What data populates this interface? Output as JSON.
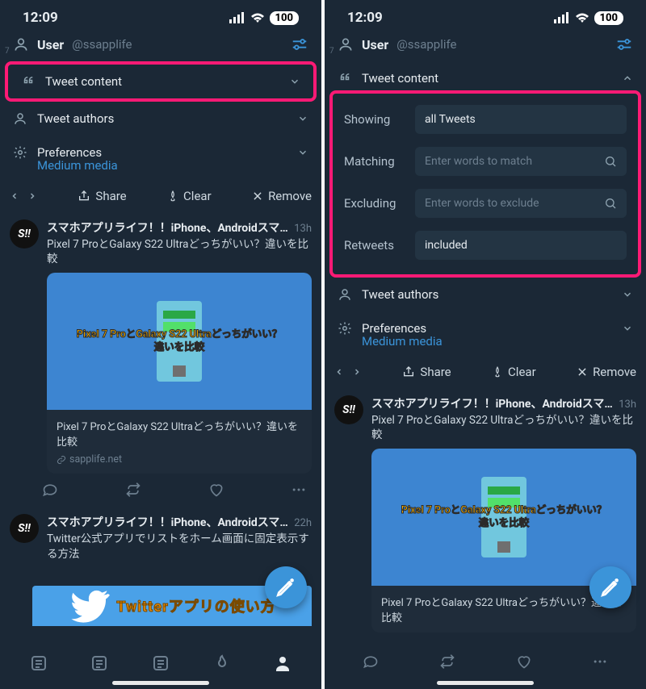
{
  "status": {
    "time": "12:09",
    "battery": "100"
  },
  "col_index_left": "7",
  "col_index_right": "7",
  "header": {
    "name": "User",
    "handle": "@ssapplife"
  },
  "sections": {
    "tweet_content": "Tweet content",
    "tweet_authors": "Tweet authors",
    "preferences": "Preferences",
    "preferences_sub": "Medium media"
  },
  "actions": {
    "share": "Share",
    "clear": "Clear",
    "remove": "Remove"
  },
  "filters": {
    "showing_label": "Showing",
    "showing_value": "all Tweets",
    "matching_label": "Matching",
    "matching_placeholder": "Enter words to match",
    "excluding_label": "Excluding",
    "excluding_placeholder": "Enter words to exclude",
    "retweets_label": "Retweets",
    "retweets_value": "included"
  },
  "tweets": [
    {
      "avatar": "S!!",
      "name": "スマホアプリライフ！！iPhone、Androidスマ…",
      "time": "13h",
      "text": "Pixel 7 ProとGalaxy S22 Ultraどっちがいい？違いを比較",
      "overlay": "Pixel 7 ProとGalaxy S22 Ultraどっちがいい？\n違いを比較",
      "card_title": "Pixel 7 ProとGalaxy S22 Ultraどっちがいい？違いを比較",
      "card_domain": "sapplife.net"
    },
    {
      "avatar": "S!!",
      "name": "スマホアプリライフ！！iPhone、Androidスマ…",
      "time": "22h",
      "text": "Twitter公式アプリでリストをホーム画面に固定表示する方法"
    }
  ],
  "banner_text": "Twitterアプリの使い方"
}
